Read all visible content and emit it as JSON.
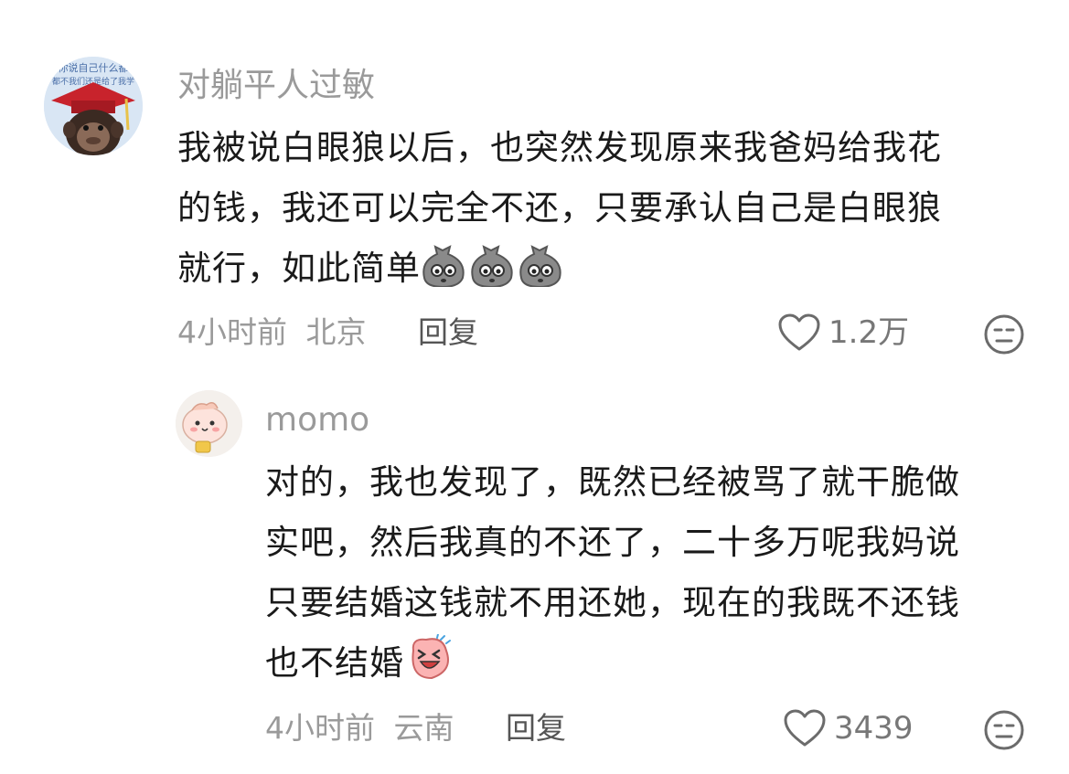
{
  "comments": [
    {
      "username": "对躺平人过敏",
      "text": "我被说白眼狼以后，也突然发现原来我爸妈给我花的钱，我还可以完全不还，只要承认自己是白眼狼就行，如此简单",
      "text_lines": [
        "我被说白眼狼以后，也突然发现原来我爸妈给我花",
        "的钱，我还可以完全不还，只要承认自己是白眼狼",
        "就行，如此简单"
      ],
      "time": "4小时前",
      "location": "北京",
      "reply_label": "回复",
      "likes": "1.2万",
      "avatar_icon": "monkey-graduate-avatar",
      "emoji_icon": "money-bag-emoji"
    },
    {
      "username": "momo",
      "text": "对的，我也发现了，既然已经被骂了就干脆做实吧，然后我真的不还了，二十多万呢我妈说只要结婚这钱就不用还她，现在的我既不还钱也不结婚",
      "text_lines": [
        "对的，我也发现了，既然已经被骂了就干脆做",
        "实吧，然后我真的不还了，二十多万呢我妈说",
        "只要结婚这钱就不用还她，现在的我既不还钱",
        "也不结婚"
      ],
      "time": "4小时前",
      "location": "云南",
      "reply_label": "回复",
      "likes": "3439",
      "avatar_icon": "pink-cartoon-avatar",
      "emoji_icon": "laughing-pink-face-emoji"
    }
  ],
  "avatar_watermark_text": [
    "你说自己什么都",
    "都不我们还是给了我学"
  ],
  "colors": {
    "text": "#1a1a1a",
    "meta": "#9a9a9a",
    "reply": "#555555",
    "icon": "#777777"
  }
}
